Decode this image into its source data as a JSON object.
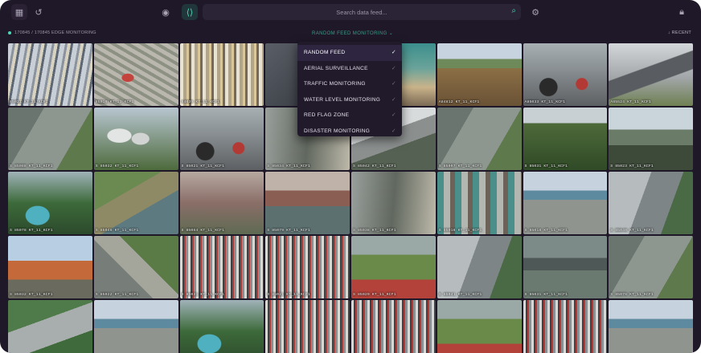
{
  "topbar": {
    "search_placeholder": "Search data feed...",
    "icons": [
      "grid-icon",
      "history-icon",
      "camera-icon",
      "live-icon",
      "search-icon",
      "settings-icon",
      "lock-icon"
    ]
  },
  "subbar": {
    "count": "170845 / 170845 EDGE MONITORING",
    "feed_selector": "RANDOM FEED MONITORING",
    "recent": "RECENT"
  },
  "dropdown": {
    "items": [
      {
        "label": "RANDOM FEED",
        "selected": true
      },
      {
        "label": "AERIAL SURVEILLANCE",
        "selected": false
      },
      {
        "label": "TRAFFIC MONITORING",
        "selected": false
      },
      {
        "label": "WATER LEVEL MONITORING",
        "selected": false
      },
      {
        "label": "RED FLAG ZONE",
        "selected": false
      },
      {
        "label": "DISASTER MONITORING",
        "selected": false
      }
    ]
  },
  "feeds": [
    {
      "label": "85021 KT_11_KCF1",
      "scene": "traffic"
    },
    {
      "label": "85016 KT_11_KCF1",
      "scene": "city"
    },
    {
      "label": "84039 KT_11_KCF1",
      "scene": "market"
    },
    {
      "label": "",
      "scene": "dark"
    },
    {
      "label": "",
      "scene": "hidden"
    },
    {
      "label": "A84812 KT_11_KCF1",
      "scene": "flood"
    },
    {
      "label": "A85033 KT_11_KCF1",
      "scene": "moto"
    },
    {
      "label": "A85524 KT_11_KCF1",
      "scene": "volcano"
    },
    {
      "label": "S 85088 KT_11_KCF1",
      "scene": "road"
    },
    {
      "label": "S 85032 KT_11_KCF1",
      "scene": "tanks"
    },
    {
      "label": "S 85021 KT_11_KCF1",
      "scene": "moto"
    },
    {
      "label": "S 85034 KT_11_KCF1",
      "scene": "street"
    },
    {
      "label": "S 85042 KT_11_KCF1",
      "scene": "roof"
    },
    {
      "label": "S 85007 KT_11_KCF1",
      "scene": "road"
    },
    {
      "label": "S 85031 KT_11_KCF1",
      "scene": "forest"
    },
    {
      "label": "S 85023 KT_11_KCF1",
      "scene": "city2"
    },
    {
      "label": "S 85078 KT_11_KCF1",
      "scene": "park"
    },
    {
      "label": "S 85046 KT_11_KCF1",
      "scene": "canal"
    },
    {
      "label": "S 85084 KT_11_KCF1",
      "scene": "bridge"
    },
    {
      "label": "S 85079 KT_11_KCF1",
      "scene": "river"
    },
    {
      "label": "S 85038 KT_11_KCF1",
      "scene": "street"
    },
    {
      "label": "S 85016 KT_11_KCF1",
      "scene": "mural"
    },
    {
      "label": "S 85018 KT_11_KCF1",
      "scene": "toll"
    },
    {
      "label": "S 85040 KT_11_KCF1",
      "scene": "highway"
    },
    {
      "label": "S 85032 KT_11_KCF1",
      "scene": "monument"
    },
    {
      "label": "S 85022 KT_11_KCF1",
      "scene": "intersection"
    },
    {
      "label": "S 85031 KT_11_KCF1",
      "scene": "jam"
    },
    {
      "label": "S 85021 KT_11_KCF1",
      "scene": "jam"
    },
    {
      "label": "S 85029 KT_11_KCF1",
      "scene": "field"
    },
    {
      "label": "S 85041 KT_11_KCF1",
      "scene": "highway"
    },
    {
      "label": "S 85031 KT_11_KCF1",
      "scene": "overpass"
    },
    {
      "label": "S 85076 KT_11_KCF1",
      "scene": "road"
    },
    {
      "label": "",
      "scene": "freeway"
    },
    {
      "label": "",
      "scene": "toll"
    },
    {
      "label": "",
      "scene": "park"
    },
    {
      "label": "",
      "scene": "jam"
    },
    {
      "label": "",
      "scene": "jam"
    },
    {
      "label": "",
      "scene": "field"
    },
    {
      "label": "",
      "scene": "jam"
    },
    {
      "label": "",
      "scene": "toll"
    }
  ],
  "colors": {
    "background": "#1f1828",
    "accent": "#4fd6b6",
    "dropdown_bg": "#211a2b"
  }
}
